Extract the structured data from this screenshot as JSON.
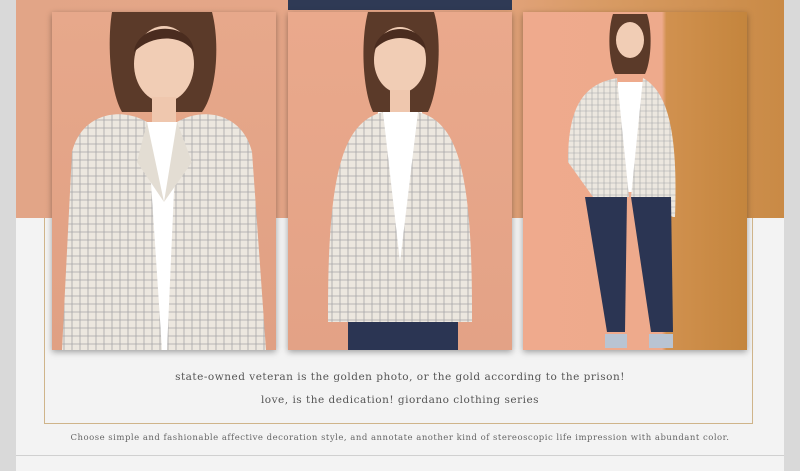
{
  "captions": {
    "line1": "state-owned veteran is the golden photo, or the gold according to the prison!",
    "line2": "love, is the dedication! giordano clothing series",
    "line3": "Choose simple and fashionable affective decoration style, and annotate another kind of stereoscopic life impression with abundant color."
  },
  "colors": {
    "hero_bg": "#e2a587",
    "gold_frame": "#cfb48a",
    "jacket": "#ebe6de",
    "jeans": "#2b3553"
  },
  "photos": [
    {
      "name": "woman-in-tweed-jacket-closeup"
    },
    {
      "name": "woman-in-tweed-jacket-waist"
    },
    {
      "name": "woman-in-tweed-jacket-fullbody"
    }
  ]
}
